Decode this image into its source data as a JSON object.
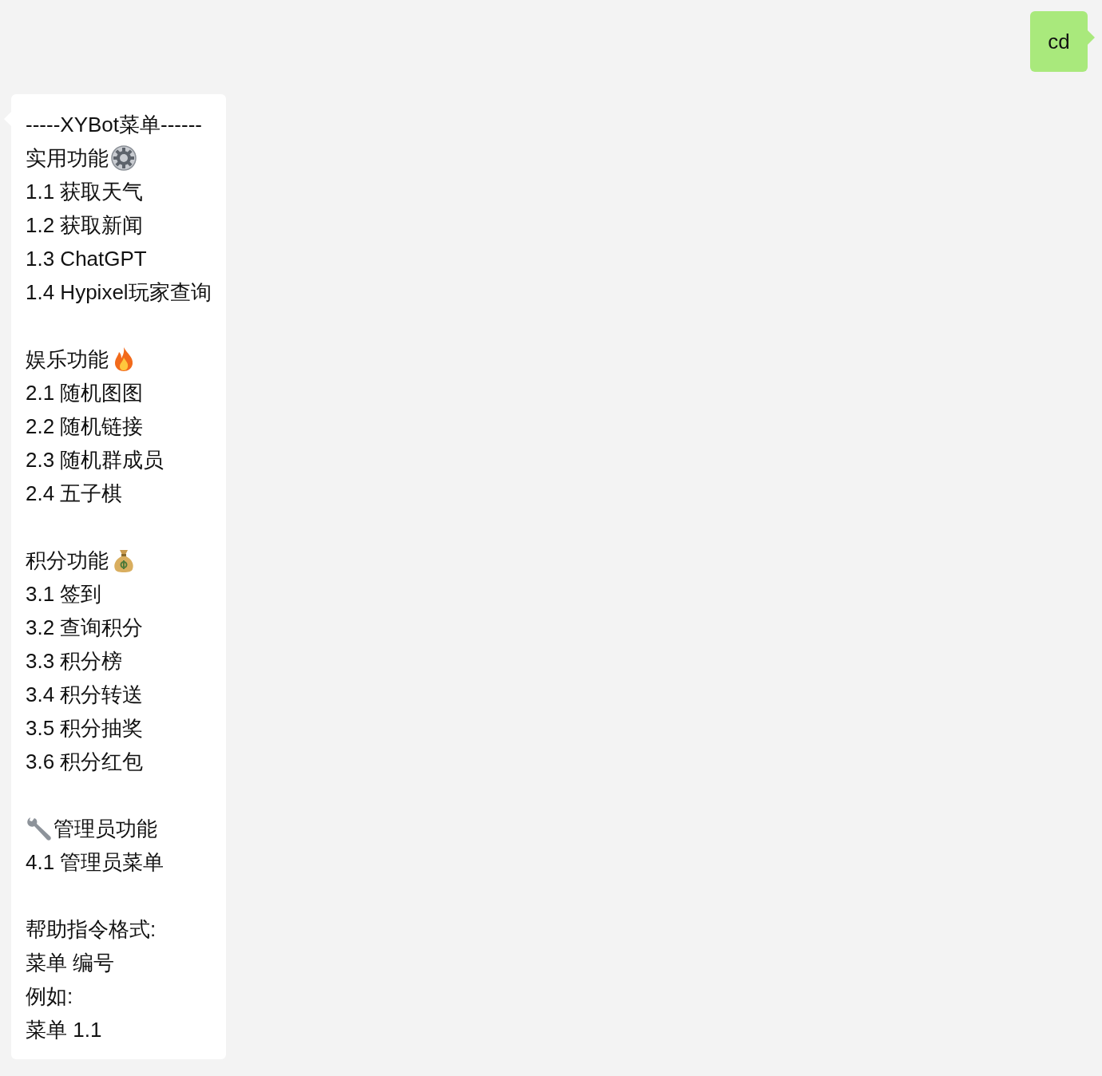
{
  "messages": [
    {
      "kind": "sent",
      "text": "cd"
    },
    {
      "kind": "received",
      "header": "-----XYBot菜单------",
      "sections": [
        {
          "kind": "utility",
          "title": "实用功能",
          "items": [
            "1.1 获取天气",
            "1.2 获取新闻",
            "1.3 ChatGPT",
            "1.4 Hypixel玩家查询"
          ]
        },
        {
          "kind": "fun",
          "title": "娱乐功能",
          "items": [
            "2.1 随机图图",
            "2.2 随机链接",
            "2.3 随机群成员",
            "2.4 五子棋"
          ]
        },
        {
          "kind": "points",
          "title": "积分功能",
          "items": [
            "3.1 签到",
            "3.2 查询积分",
            "3.3 积分榜",
            "3.4 积分转送",
            "3.5 积分抽奖",
            "3.6 积分红包"
          ]
        },
        {
          "kind": "admin",
          "title": "管理员功能",
          "items": [
            "4.1 管理员菜单"
          ]
        }
      ],
      "footer": [
        "帮助指令格式:",
        "菜单 编号",
        "例如:",
        "菜单 1.1"
      ]
    }
  ]
}
